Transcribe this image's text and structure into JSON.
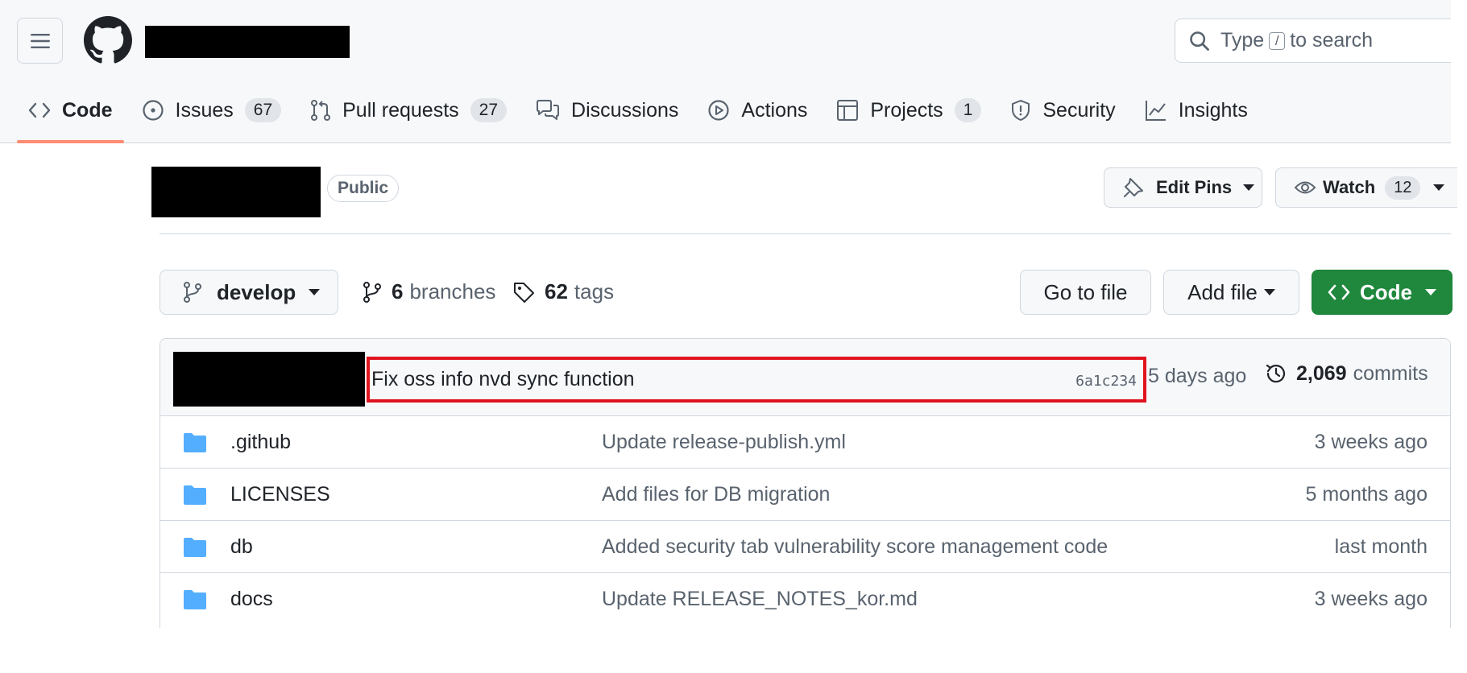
{
  "search": {
    "prefix": "Type",
    "key": "/",
    "suffix": "to search"
  },
  "nav": {
    "tabs": [
      {
        "label": "Code",
        "icon": "code-icon",
        "selected": true
      },
      {
        "label": "Issues",
        "icon": "issue-icon",
        "count": "67"
      },
      {
        "label": "Pull requests",
        "icon": "pull-request-icon",
        "count": "27"
      },
      {
        "label": "Discussions",
        "icon": "discussion-icon"
      },
      {
        "label": "Actions",
        "icon": "play-icon"
      },
      {
        "label": "Projects",
        "icon": "table-icon",
        "count": "1"
      },
      {
        "label": "Security",
        "icon": "shield-icon"
      },
      {
        "label": "Insights",
        "icon": "graph-icon"
      }
    ]
  },
  "repo": {
    "visibility": "Public",
    "edit_pins_label": "Edit Pins",
    "watch_label": "Watch",
    "watch_count": "12"
  },
  "branch": {
    "current": "develop",
    "branches_count": "6",
    "branches_label": "branches",
    "tags_count": "62",
    "tags_label": "tags",
    "go_to_file_label": "Go to file",
    "add_file_label": "Add file",
    "code_label": "Code"
  },
  "latest_commit": {
    "message": "Fix oss info nvd sync function",
    "sha": "6a1c234",
    "time": "5 days ago",
    "commit_count": "2,069",
    "commit_label": "commits"
  },
  "files": [
    {
      "name": ".github",
      "message": "Update release-publish.yml",
      "time": "3 weeks ago"
    },
    {
      "name": "LICENSES",
      "message": "Add files for DB migration",
      "time": "5 months ago"
    },
    {
      "name": "db",
      "message": "Added security tab vulnerability score management code",
      "time": "last month"
    },
    {
      "name": "docs",
      "message": "Update RELEASE_NOTES_kor.md",
      "time": "3 weeks ago"
    }
  ],
  "colors": {
    "accent_underline": "#fd8c73",
    "code_button": "#1f883d",
    "folder": "#54aeff",
    "highlight_box": "#e0141e"
  }
}
